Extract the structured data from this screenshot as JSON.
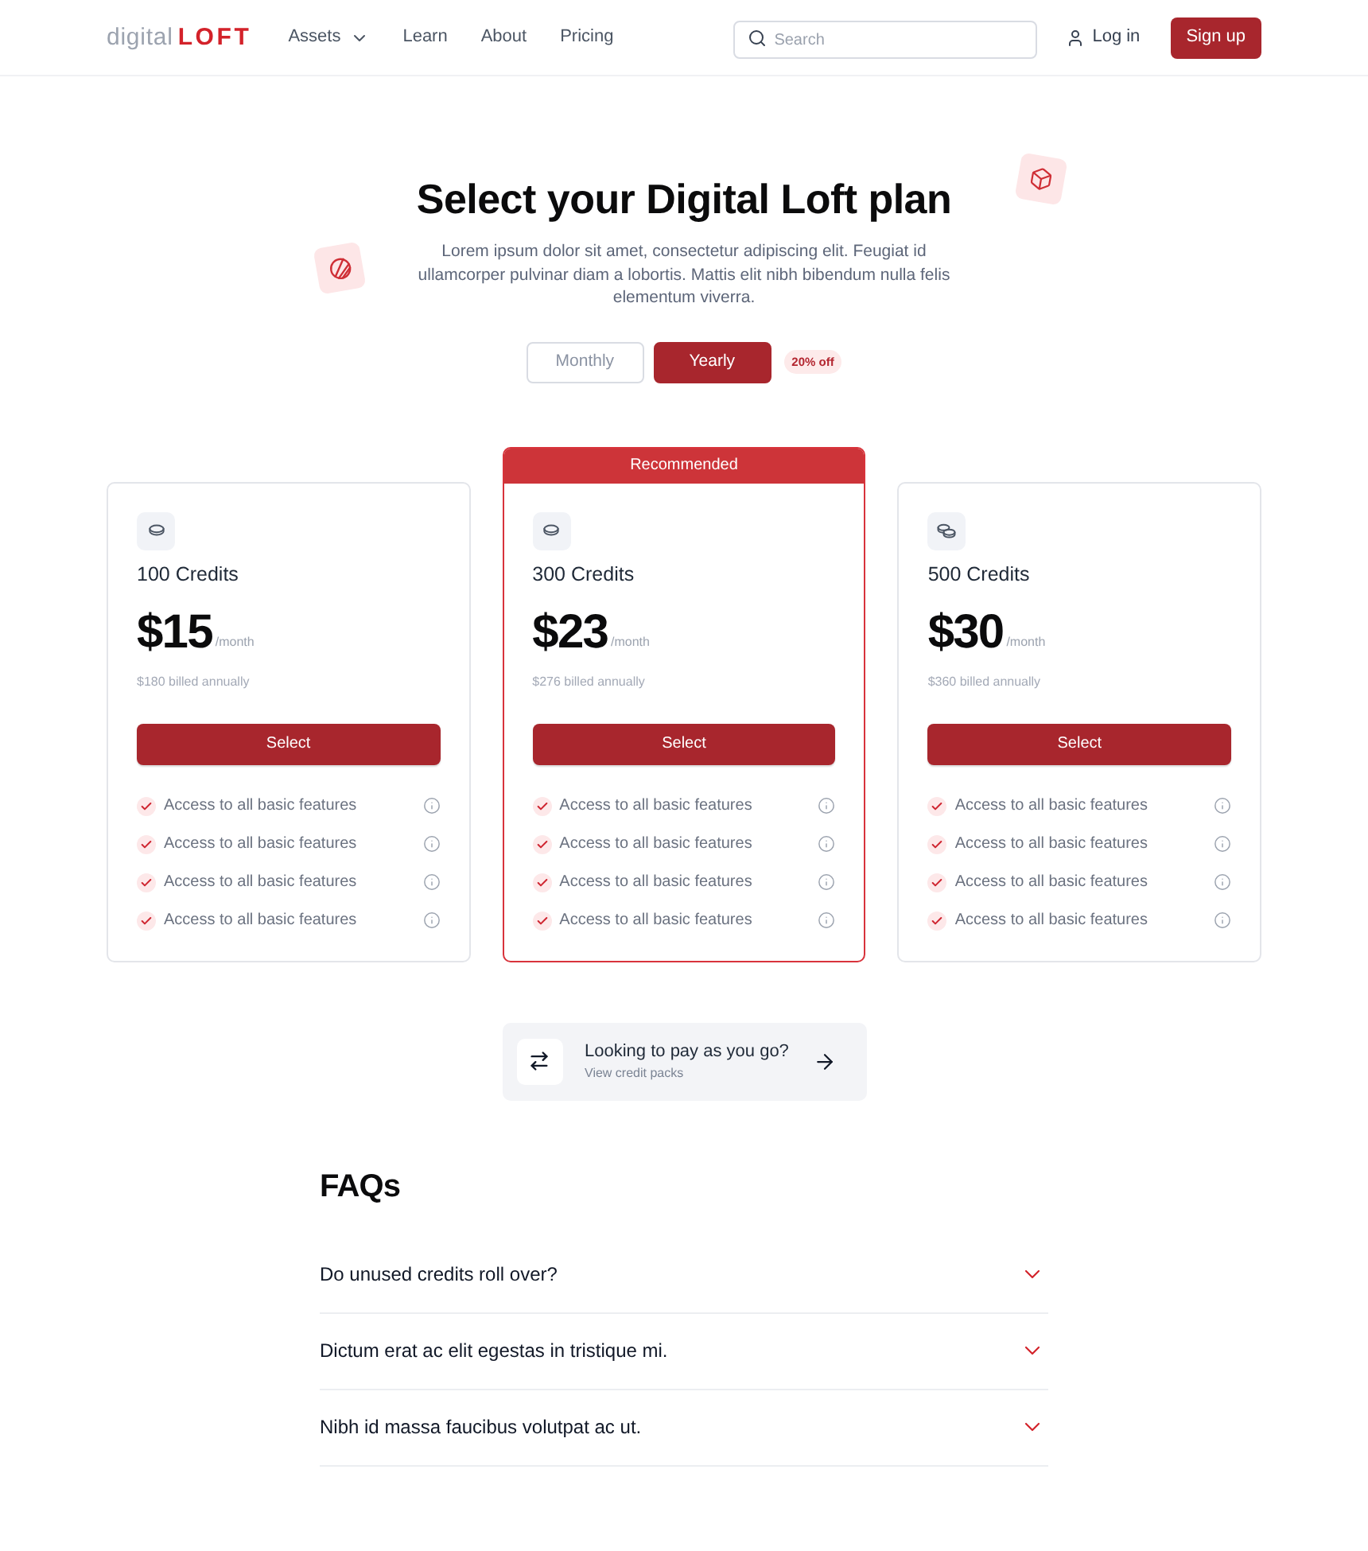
{
  "header": {
    "logo": {
      "prefix": "digital",
      "suffix": "LOFT"
    },
    "nav": [
      {
        "label": "Assets",
        "kind": "dropdown"
      },
      {
        "label": "Learn",
        "kind": "link"
      },
      {
        "label": "About",
        "kind": "link"
      },
      {
        "label": "Pricing",
        "kind": "link"
      }
    ],
    "search": {
      "placeholder": "Search"
    },
    "login": "Log in",
    "signup": "Sign up"
  },
  "hero": {
    "title": "Select your Digital Loft plan",
    "description": "Lorem ipsum dolor sit amet, consectetur adipiscing elit. Feugiat id ullamcorper pulvinar diam a lobortis. Mattis elit nibh bibendum nulla felis elementum viverra."
  },
  "billing_toggle": {
    "options": [
      {
        "label": "Monthly",
        "selected": false
      },
      {
        "label": "Yearly",
        "selected": true
      }
    ],
    "badge": "20% off"
  },
  "pricing": {
    "recommended_label": "Recommended",
    "plans": [
      {
        "name": "100 Credits",
        "price": "$15",
        "period": "/month",
        "billed": "$180 billed annually",
        "button": "Select",
        "recommended": false,
        "features": [
          "Access to all basic features",
          "Access to all basic features",
          "Access to all basic features",
          "Access to all basic features"
        ]
      },
      {
        "name": "300 Credits",
        "price": "$23",
        "period": "/month",
        "billed": "$276 billed annually",
        "button": "Select",
        "recommended": true,
        "features": [
          "Access to all basic features",
          "Access to all basic features",
          "Access to all basic features",
          "Access to all basic features"
        ]
      },
      {
        "name": "500 Credits",
        "price": "$30",
        "period": "/month",
        "billed": "$360 billed annually",
        "button": "Select",
        "recommended": false,
        "features": [
          "Access to all basic features",
          "Access to all basic features",
          "Access to all basic features",
          "Access to all basic features"
        ]
      }
    ]
  },
  "pay_as_you_go": {
    "title": "Looking to pay as you go?",
    "subtitle": "View credit packs"
  },
  "faqs": {
    "title": "FAQs",
    "items": [
      {
        "question": "Do unused credits roll over?",
        "expanded": false
      },
      {
        "question": "Dictum erat ac elit egestas in tristique mi.",
        "expanded": false
      },
      {
        "question": "Nibh id massa faucibus volutpat ac ut.",
        "expanded": false
      }
    ]
  }
}
